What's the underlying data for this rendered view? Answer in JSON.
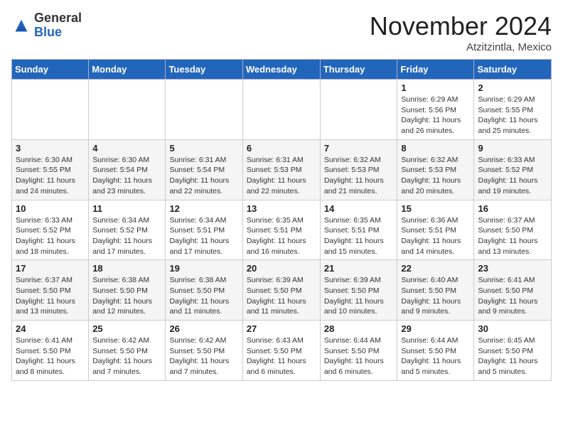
{
  "header": {
    "logo_general": "General",
    "logo_blue": "Blue",
    "month_title": "November 2024",
    "location": "Atzitzintla, Mexico"
  },
  "weekdays": [
    "Sunday",
    "Monday",
    "Tuesday",
    "Wednesday",
    "Thursday",
    "Friday",
    "Saturday"
  ],
  "weeks": [
    [
      {
        "day": "",
        "info": ""
      },
      {
        "day": "",
        "info": ""
      },
      {
        "day": "",
        "info": ""
      },
      {
        "day": "",
        "info": ""
      },
      {
        "day": "",
        "info": ""
      },
      {
        "day": "1",
        "info": "Sunrise: 6:29 AM\nSunset: 5:56 PM\nDaylight: 11 hours and 26 minutes."
      },
      {
        "day": "2",
        "info": "Sunrise: 6:29 AM\nSunset: 5:55 PM\nDaylight: 11 hours and 25 minutes."
      }
    ],
    [
      {
        "day": "3",
        "info": "Sunrise: 6:30 AM\nSunset: 5:55 PM\nDaylight: 11 hours and 24 minutes."
      },
      {
        "day": "4",
        "info": "Sunrise: 6:30 AM\nSunset: 5:54 PM\nDaylight: 11 hours and 23 minutes."
      },
      {
        "day": "5",
        "info": "Sunrise: 6:31 AM\nSunset: 5:54 PM\nDaylight: 11 hours and 22 minutes."
      },
      {
        "day": "6",
        "info": "Sunrise: 6:31 AM\nSunset: 5:53 PM\nDaylight: 11 hours and 22 minutes."
      },
      {
        "day": "7",
        "info": "Sunrise: 6:32 AM\nSunset: 5:53 PM\nDaylight: 11 hours and 21 minutes."
      },
      {
        "day": "8",
        "info": "Sunrise: 6:32 AM\nSunset: 5:53 PM\nDaylight: 11 hours and 20 minutes."
      },
      {
        "day": "9",
        "info": "Sunrise: 6:33 AM\nSunset: 5:52 PM\nDaylight: 11 hours and 19 minutes."
      }
    ],
    [
      {
        "day": "10",
        "info": "Sunrise: 6:33 AM\nSunset: 5:52 PM\nDaylight: 11 hours and 18 minutes."
      },
      {
        "day": "11",
        "info": "Sunrise: 6:34 AM\nSunset: 5:52 PM\nDaylight: 11 hours and 17 minutes."
      },
      {
        "day": "12",
        "info": "Sunrise: 6:34 AM\nSunset: 5:51 PM\nDaylight: 11 hours and 17 minutes."
      },
      {
        "day": "13",
        "info": "Sunrise: 6:35 AM\nSunset: 5:51 PM\nDaylight: 11 hours and 16 minutes."
      },
      {
        "day": "14",
        "info": "Sunrise: 6:35 AM\nSunset: 5:51 PM\nDaylight: 11 hours and 15 minutes."
      },
      {
        "day": "15",
        "info": "Sunrise: 6:36 AM\nSunset: 5:51 PM\nDaylight: 11 hours and 14 minutes."
      },
      {
        "day": "16",
        "info": "Sunrise: 6:37 AM\nSunset: 5:50 PM\nDaylight: 11 hours and 13 minutes."
      }
    ],
    [
      {
        "day": "17",
        "info": "Sunrise: 6:37 AM\nSunset: 5:50 PM\nDaylight: 11 hours and 13 minutes."
      },
      {
        "day": "18",
        "info": "Sunrise: 6:38 AM\nSunset: 5:50 PM\nDaylight: 11 hours and 12 minutes."
      },
      {
        "day": "19",
        "info": "Sunrise: 6:38 AM\nSunset: 5:50 PM\nDaylight: 11 hours and 11 minutes."
      },
      {
        "day": "20",
        "info": "Sunrise: 6:39 AM\nSunset: 5:50 PM\nDaylight: 11 hours and 11 minutes."
      },
      {
        "day": "21",
        "info": "Sunrise: 6:39 AM\nSunset: 5:50 PM\nDaylight: 11 hours and 10 minutes."
      },
      {
        "day": "22",
        "info": "Sunrise: 6:40 AM\nSunset: 5:50 PM\nDaylight: 11 hours and 9 minutes."
      },
      {
        "day": "23",
        "info": "Sunrise: 6:41 AM\nSunset: 5:50 PM\nDaylight: 11 hours and 9 minutes."
      }
    ],
    [
      {
        "day": "24",
        "info": "Sunrise: 6:41 AM\nSunset: 5:50 PM\nDaylight: 11 hours and 8 minutes."
      },
      {
        "day": "25",
        "info": "Sunrise: 6:42 AM\nSunset: 5:50 PM\nDaylight: 11 hours and 7 minutes."
      },
      {
        "day": "26",
        "info": "Sunrise: 6:42 AM\nSunset: 5:50 PM\nDaylight: 11 hours and 7 minutes."
      },
      {
        "day": "27",
        "info": "Sunrise: 6:43 AM\nSunset: 5:50 PM\nDaylight: 11 hours and 6 minutes."
      },
      {
        "day": "28",
        "info": "Sunrise: 6:44 AM\nSunset: 5:50 PM\nDaylight: 11 hours and 6 minutes."
      },
      {
        "day": "29",
        "info": "Sunrise: 6:44 AM\nSunset: 5:50 PM\nDaylight: 11 hours and 5 minutes."
      },
      {
        "day": "30",
        "info": "Sunrise: 6:45 AM\nSunset: 5:50 PM\nDaylight: 11 hours and 5 minutes."
      }
    ]
  ]
}
